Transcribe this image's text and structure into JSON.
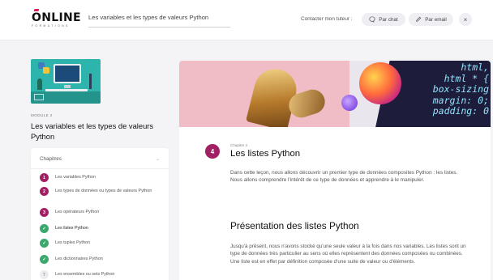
{
  "header": {
    "logo_text": "ONLINE",
    "logo_subtext": "FORMATIONS",
    "course_title": "Les variables et les types de valeurs Python",
    "contact_label": "Contacter mon tuteur :",
    "chat_label": "Par chat",
    "email_label": "Par email",
    "close_label": "×"
  },
  "sidebar": {
    "module_label": "MODULE 2",
    "module_title": "Les variables et les types de valeurs Python",
    "chapters_header": "Chapitres",
    "chapters_chevron": "⌄",
    "items": [
      {
        "marker": "1",
        "label": "Les variables Python"
      },
      {
        "marker": "2",
        "label": "Les types de données ou types de valeurs Python"
      },
      {
        "marker": "3",
        "label": "Les opérateurs Python"
      },
      {
        "marker": "✓",
        "label": "Les listes Python"
      },
      {
        "marker": "✓",
        "label": "Les tuples Python"
      },
      {
        "marker": "✓",
        "label": "Les dictionnaires Python"
      },
      {
        "marker": "7",
        "label": "Les ensembles ou sets Python"
      }
    ]
  },
  "hero": {
    "code_text": "html,\nhtml * {\n box-sizing\n margin: 0;\n padding: 0"
  },
  "main": {
    "chapter_number": "4",
    "chapter_kicker": "Chapitre 4",
    "chapter_title": "Les listes Python",
    "intro": "Dans cette leçon, nous allons découvrir un premier type de données composites Python : les listes. Nous allons comprendre l'intérêt de ce type de données et apprendre à le manipuler.",
    "section_title": "Présentation des listes Python",
    "body": "Jusqu'à présent, nous n'avons stocké qu'une seule valeur à la fois dans nos variables. Les listes sont un type de données très particulier au sens où elles représentent des données composées ou combinées. Une liste est en effet par définition composée d'une suite de valeur ou d'éléments."
  },
  "colors": {
    "accent": "#a21f63",
    "done": "#3aa76d",
    "logo_accent": "#d81b5f"
  }
}
